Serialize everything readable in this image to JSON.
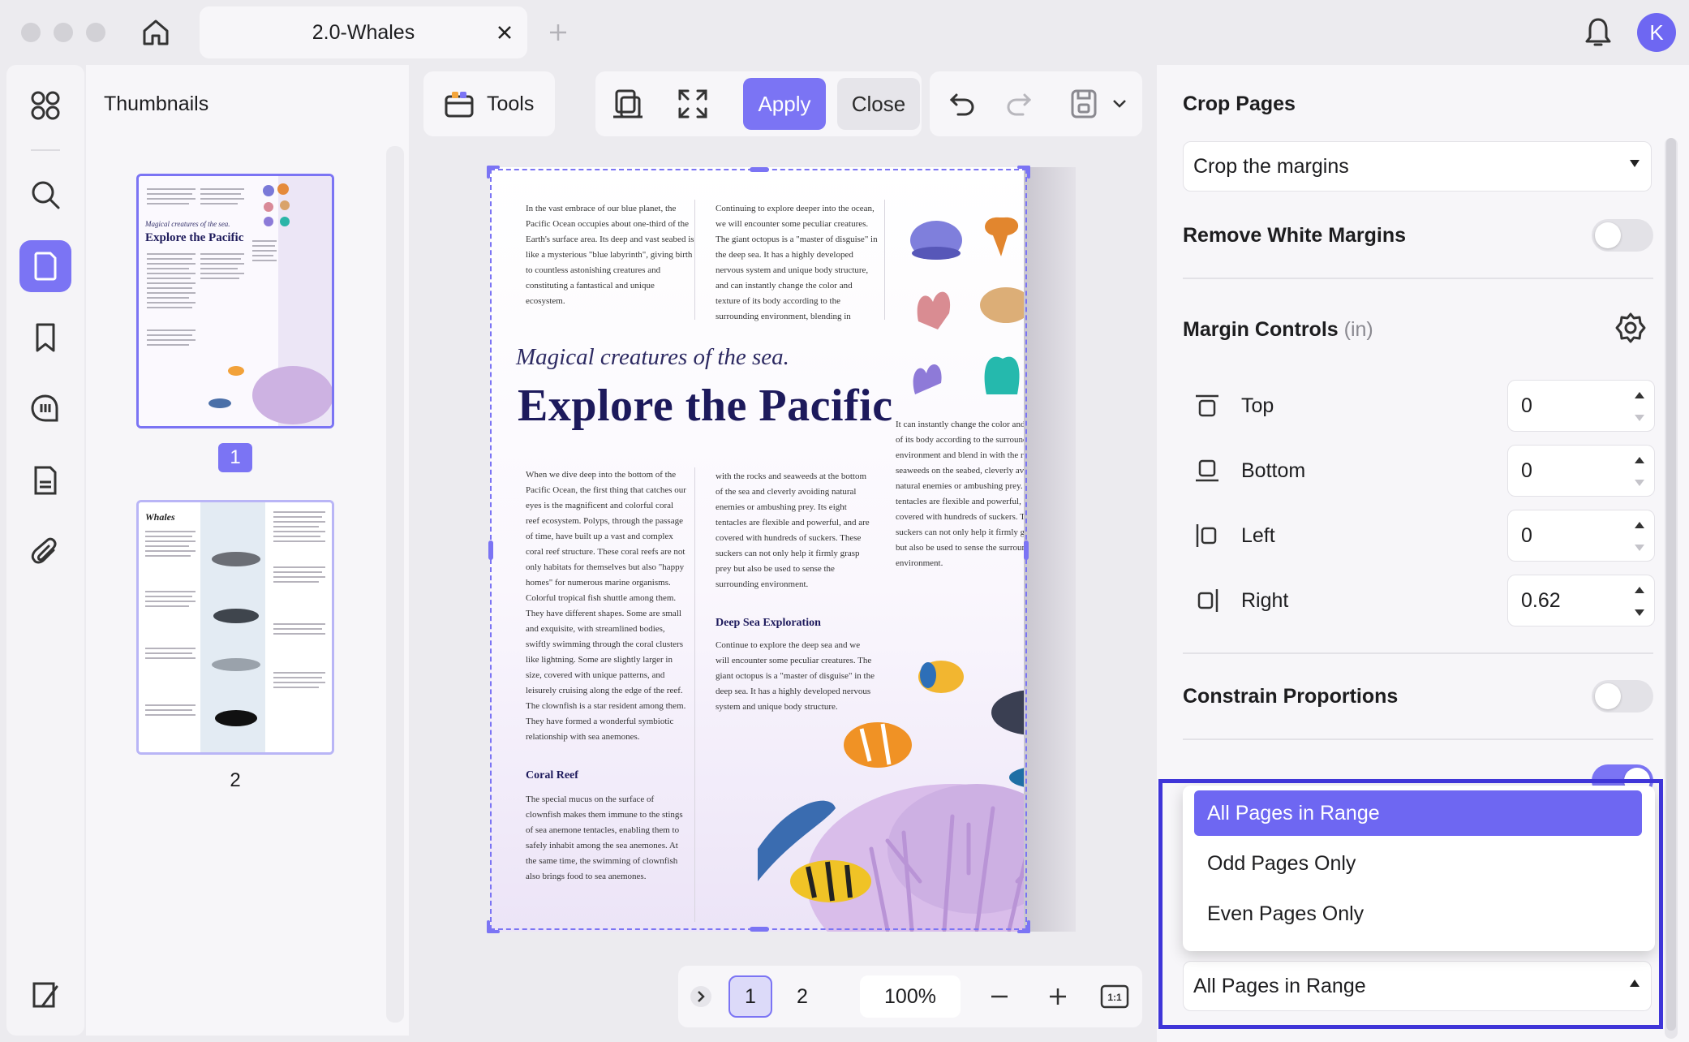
{
  "window": {
    "tab_title": "2.0-Whales",
    "avatar_initial": "K"
  },
  "sidebar": {
    "items": [
      {
        "icon": "grid-icon"
      },
      {
        "icon": "search-icon"
      },
      {
        "icon": "page-icon",
        "active": true
      },
      {
        "icon": "bookmark-icon"
      },
      {
        "icon": "comment-icon"
      },
      {
        "icon": "form-icon"
      },
      {
        "icon": "attachment-icon"
      }
    ],
    "bottom_icon": "panel-toggle-icon"
  },
  "thumbnails": {
    "title": "Thumbnails",
    "pages": [
      {
        "number": "1",
        "selected": true
      },
      {
        "number": "2",
        "selected": false
      }
    ]
  },
  "toolbar": {
    "tools_label": "Tools",
    "apply_label": "Apply",
    "close_label": "Close"
  },
  "document": {
    "col1_top": "In the vast embrace of our blue planet, the Pacific Ocean occupies about one-third of the Earth's surface area. Its deep and vast seabed is like a mysterious \"blue labyrinth\", giving birth to countless astonishing creatures and constituting a fantastical and unique ecosystem.",
    "col2_top": "Continuing to explore deeper into the ocean, we will encounter some peculiar creatures. The giant octopus is a \"master of disguise\" in the deep sea. It has a highly developed nervous system and unique body structure, and can instantly change the color and texture of its body according to the surrounding environment, blending in",
    "subtitle": "Magical creatures of the sea.",
    "title": "Explore the Pacific",
    "col3_mid": "It can instantly change the color and texture of its body according to the surrounding environment and blend in with the rocks and seaweeds on the seabed, cleverly avoiding natural enemies or ambushing prey. Its eight tentacles are flexible and powerful, and are covered with hundreds of suckers. These suckers can not only help it firmly grasp prey but also be used to sense the surrounding environment.",
    "col1_body": "When we dive deep into the bottom of the Pacific Ocean, the first thing that catches our eyes is the magnificent and colorful coral reef ecosystem. Polyps, through the passage of time, have built up a vast and complex coral reef structure. These coral reefs are not only habitats for themselves but also \"happy homes\" for numerous marine organisms. Colorful tropical fish shuttle among them. They have different shapes. Some are small and exquisite, with streamlined bodies, swiftly swimming through the coral clusters like lightning. Some are slightly larger in size, covered with unique patterns, and leisurely cruising along the edge of the reef. The clownfish is a star resident among them. They have formed a wonderful symbiotic relationship with sea anemones.",
    "col2_body": "with the rocks and seaweeds at the bottom of the sea and cleverly avoiding natural enemies or ambushing prey. Its eight tentacles are flexible and powerful, and are covered with hundreds of suckers. These suckers can not only help it firmly grasp prey but also be used to sense the surrounding environment.",
    "heading_deep": "Deep Sea Exploration",
    "deep_body": "Continue to explore the deep sea and we will encounter some peculiar creatures. The giant octopus is a \"master of disguise\" in the deep sea. It has a highly developed nervous system and unique body structure.",
    "heading_coral": "Coral Reef",
    "coral_body": "The special mucus on the surface of clownfish makes them immune to the stings of sea anemone tentacles, enabling them to safely inhabit among the sea anemones. At the same time, the swimming of clownfish also brings food to sea anemones."
  },
  "pagination": {
    "pages": [
      "1",
      "2"
    ],
    "current": "1",
    "zoom": "100%"
  },
  "crop_panel": {
    "title": "Crop Pages",
    "mode": "Crop the margins",
    "remove_white_margins": "Remove White Margins",
    "margin_controls": "Margin Controls",
    "margin_unit": "(in)",
    "margins": [
      {
        "label": "Top",
        "value": "0",
        "icon": "margin-top-icon"
      },
      {
        "label": "Bottom",
        "value": "0",
        "icon": "margin-bottom-icon"
      },
      {
        "label": "Left",
        "value": "0",
        "icon": "margin-left-icon"
      },
      {
        "label": "Right",
        "value": "0.62",
        "icon": "margin-right-icon"
      }
    ],
    "constrain_proportions": "Constrain Proportions",
    "range_options": [
      "All Pages in Range",
      "Odd Pages Only",
      "Even Pages Only"
    ],
    "range_selected": "All Pages in Range"
  },
  "colors": {
    "accent": "#7b74f4",
    "highlight_frame": "#3f35d8"
  }
}
